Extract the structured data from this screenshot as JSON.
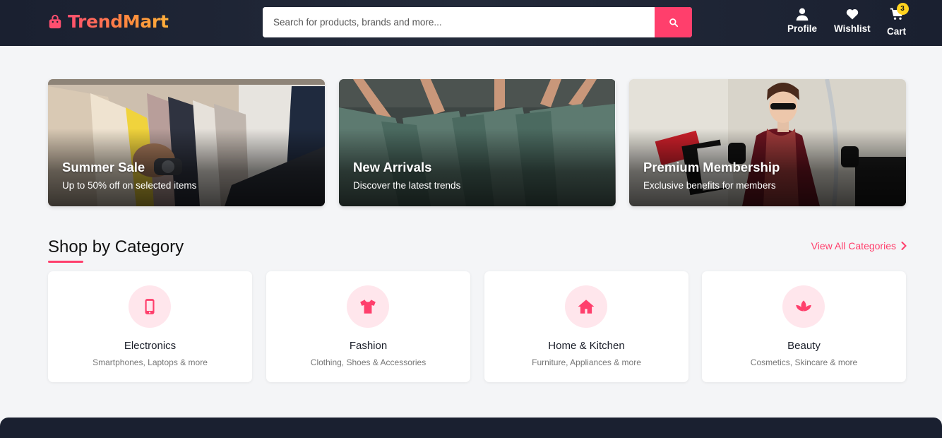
{
  "header": {
    "logo_text": "TrendMart",
    "search_placeholder": "Search for products, brands and more...",
    "nav": {
      "profile_label": "Profile",
      "wishlist_label": "Wishlist",
      "cart_label": "Cart",
      "cart_count": "3"
    }
  },
  "banners": [
    {
      "title": "Summer Sale",
      "subtitle": "Up to 50% off on selected items"
    },
    {
      "title": "New Arrivals",
      "subtitle": "Discover the latest trends"
    },
    {
      "title": "Premium Membership",
      "subtitle": "Exclusive benefits for members"
    }
  ],
  "categories_section": {
    "title": "Shop by Category",
    "view_all_label": "View All Categories",
    "items": [
      {
        "name": "Electronics",
        "desc": "Smartphones, Laptops & more",
        "icon": "mobile-icon"
      },
      {
        "name": "Fashion",
        "desc": "Clothing, Shoes & Accessories",
        "icon": "tshirt-icon"
      },
      {
        "name": "Home & Kitchen",
        "desc": "Furniture, Appliances & more",
        "icon": "home-icon"
      },
      {
        "name": "Beauty",
        "desc": "Cosmetics, Skincare & more",
        "icon": "lotus-icon"
      }
    ]
  },
  "colors": {
    "accent": "#ff3f6c",
    "header_bg": "#1a2030",
    "badge": "#ffd21f",
    "icon_bg": "#ffe6ec"
  }
}
